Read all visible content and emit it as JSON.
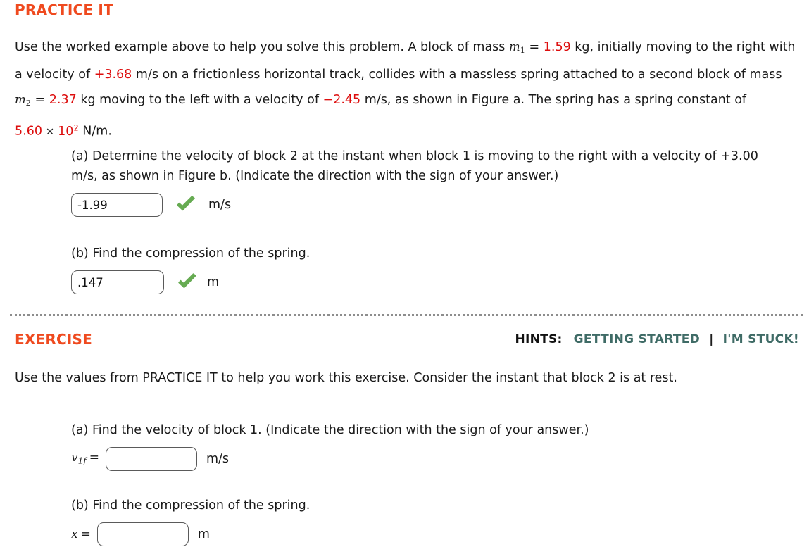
{
  "practice": {
    "heading": "PRACTICE IT",
    "prompt": {
      "s1": "Use the worked example above to help you solve this problem. A block of mass ",
      "m1_var": "m",
      "m1_sub": "1",
      "eq1": " = ",
      "m1_value": "1.59",
      "s2": " kg, initially moving to the right with a velocity of ",
      "v1_value": "+3.68",
      "s3": " m/s on a frictionless horizontal track, collides with a massless spring attached to a second block of mass ",
      "m2_var": "m",
      "m2_sub": "2",
      "eq2": " = ",
      "m2_value": "2.37",
      "s4": " kg moving to the left with a velocity of ",
      "v2_value": "−2.45",
      "s5": " m/s, as shown in Figure a. The spring has a spring constant of ",
      "k_mantissa": "5.60",
      "k_times": "×",
      "k_base": "10",
      "k_exponent": "2",
      "s6": " N/m."
    },
    "part_a": {
      "question": "(a) Determine the velocity of block 2 at the instant when block 1 is moving to the right with a velocity of +3.00 m/s, as shown in Figure b. (Indicate the direction with the sign of your answer.)",
      "value": "-1.99",
      "placeholder": "",
      "unit": "m/s",
      "status_icon": "green-check-icon"
    },
    "part_b": {
      "question": "(b) Find the compression of the spring.",
      "value": ".147",
      "placeholder": "",
      "unit": "m",
      "status_icon": "green-check-icon"
    }
  },
  "exercise": {
    "heading": "EXERCISE",
    "hints": {
      "label": "HINTS:",
      "getting_started": "GETTING STARTED",
      "separator": "|",
      "im_stuck": "I'M STUCK!"
    },
    "prompt": "Use the values from PRACTICE IT to help you work this exercise. Consider the instant that block 2 is at rest.",
    "part_a": {
      "question": "(a) Find the velocity of block 1. (Indicate the direction with the sign of your answer.)",
      "label_var": "v",
      "label_sub": "1f",
      "label_eq": "=",
      "value": "",
      "placeholder": "",
      "unit": "m/s"
    },
    "part_b": {
      "question": "(b) Find the compression of the spring.",
      "label_var": "x",
      "label_sub": "",
      "label_eq": "=",
      "value": "",
      "placeholder": "",
      "unit": "m"
    }
  },
  "colors": {
    "heading": "#ef4a1f",
    "value_red": "#dd0e0e",
    "hint_link": "#3f6b66",
    "check_green": "#66ab52",
    "divider": "#8d8d8d"
  }
}
